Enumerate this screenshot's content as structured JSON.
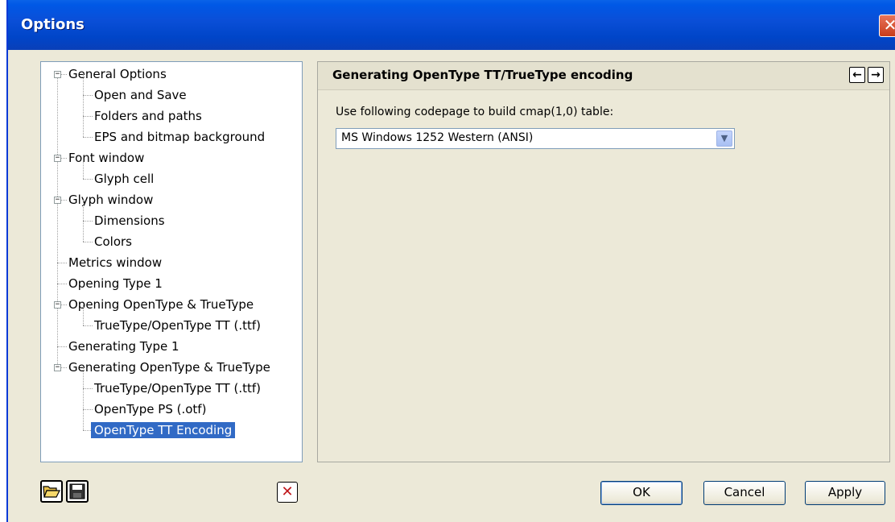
{
  "window": {
    "title": "Options",
    "close_glyph": "✕"
  },
  "tree": {
    "expander_glyph": "−",
    "items": [
      {
        "label": "General Options",
        "level": 0,
        "expandable": true
      },
      {
        "label": "Open and Save",
        "level": 1
      },
      {
        "label": "Folders and paths",
        "level": 1
      },
      {
        "label": "EPS and bitmap background",
        "level": 1
      },
      {
        "label": "Font window",
        "level": 0,
        "expandable": true
      },
      {
        "label": "Glyph cell",
        "level": 1
      },
      {
        "label": "Glyph window",
        "level": 0,
        "expandable": true
      },
      {
        "label": "Dimensions",
        "level": 1
      },
      {
        "label": "Colors",
        "level": 1
      },
      {
        "label": "Metrics window",
        "level": 0
      },
      {
        "label": "Opening Type 1",
        "level": 0
      },
      {
        "label": "Opening OpenType & TrueType",
        "level": 0,
        "expandable": true
      },
      {
        "label": "TrueType/OpenType TT (.ttf)",
        "level": 1
      },
      {
        "label": "Generating Type 1",
        "level": 0
      },
      {
        "label": "Generating OpenType & TrueType",
        "level": 0,
        "expandable": true
      },
      {
        "label": "TrueType/OpenType TT (.ttf)",
        "level": 1
      },
      {
        "label": "OpenType PS (.otf)",
        "level": 1
      },
      {
        "label": "OpenType TT Encoding",
        "level": 1,
        "selected": true
      }
    ]
  },
  "panel": {
    "title": "Generating OpenType TT/TrueType encoding",
    "back_glyph": "←",
    "forward_glyph": "→",
    "codepage_label": "Use following codepage to build cmap(1,0) table:",
    "codepage_value": "MS Windows 1252 Western (ANSI)",
    "dropdown_glyph": "▼"
  },
  "footer": {
    "delete_glyph": "✕",
    "ok_label": "OK",
    "cancel_label": "Cancel",
    "apply_label": "Apply"
  },
  "icons": {
    "open": "open-folder-icon",
    "save": "save-disk-icon",
    "delete": "delete-x-icon"
  },
  "colors": {
    "titlebar": "#0a4fd8",
    "selection": "#316ac5",
    "dialog_bg": "#ece9d8",
    "delete_red": "#c0171b"
  }
}
